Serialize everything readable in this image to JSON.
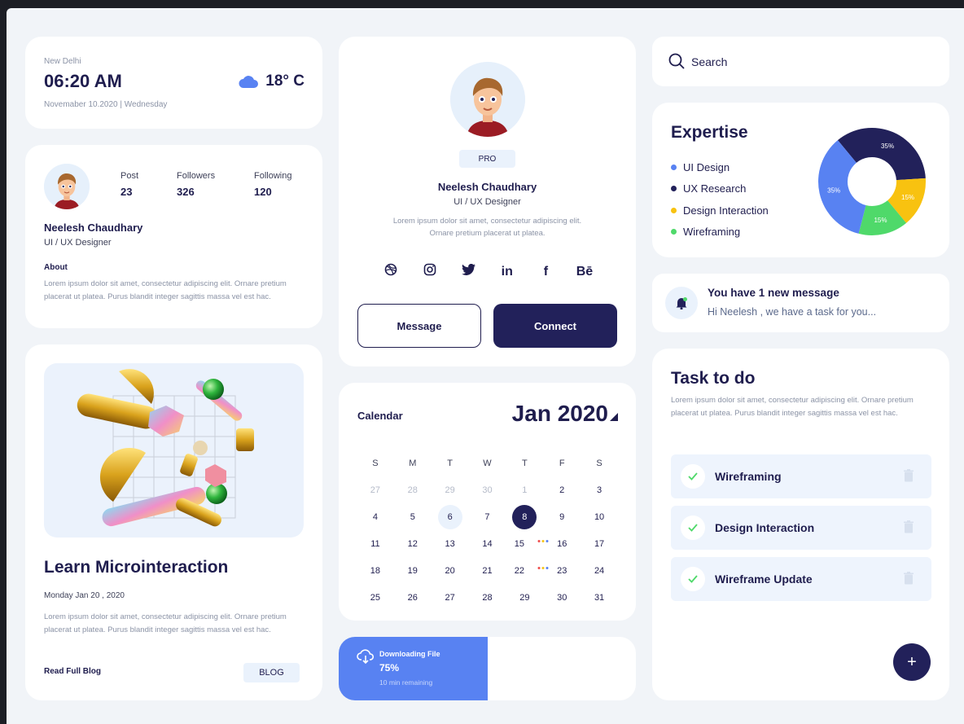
{
  "weather": {
    "city": "New Delhi",
    "time": "06:20 AM",
    "date": "Novemaber 10.2020 | Wednesday",
    "temperature": "18° C",
    "icon": "cloud-icon"
  },
  "profile_small": {
    "stats": [
      {
        "label": "Post",
        "value": "23"
      },
      {
        "label": "Followers",
        "value": "326"
      },
      {
        "label": "Following",
        "value": "120"
      }
    ],
    "name": "Neelesh Chaudhary",
    "role": "UI / UX Designer",
    "about_label": "About",
    "about_text": "Lorem ipsum dolor sit amet, consectetur adipiscing elit. Ornare pretium placerat ut platea. Purus blandit integer sagittis massa vel est hac."
  },
  "blog": {
    "title": "Learn Microinteraction",
    "date": "Monday Jan 20 , 2020",
    "text": "Lorem ipsum dolor sit amet, consectetur adipiscing elit. Ornare pretium placerat ut platea. Purus blandit integer sagittis massa vel est hac.",
    "read_link": "Read Full Blog",
    "tag": "BLOG"
  },
  "profile_big": {
    "badge": "PRO",
    "name": "Neelesh Chaudhary",
    "role": "UI / UX Designer",
    "bio": "Lorem ipsum dolor sit amet, consectetur adipiscing elit. Ornare pretium placerat ut platea.",
    "socials": [
      "dribbble-icon",
      "instagram-icon",
      "twitter-icon",
      "linkedin-icon",
      "facebook-icon",
      "behance-icon"
    ],
    "social_glyphs": {
      "linkedin": "in",
      "facebook": "f",
      "behance": "Bē"
    },
    "message_label": "Message",
    "connect_label": "Connect"
  },
  "calendar": {
    "label": "Calendar",
    "month": "Jan 2020",
    "weekdays": [
      "S",
      "M",
      "T",
      "W",
      "T",
      "F",
      "S"
    ],
    "prev_days": [
      "27",
      "28",
      "29",
      "30",
      "1"
    ],
    "days": [
      "2",
      "3",
      "4",
      "5",
      "6",
      "7",
      "8",
      "9",
      "10",
      "11",
      "12",
      "13",
      "14",
      "15",
      "16",
      "17",
      "18",
      "19",
      "20",
      "21",
      "22",
      "23",
      "24",
      "25",
      "26",
      "27",
      "28",
      "29",
      "30",
      "31"
    ],
    "today": "6",
    "selected": "8",
    "event_days": [
      "15",
      "22"
    ],
    "event_dot_colors": [
      "#ef4d4d",
      "#f5c518",
      "#5882f2"
    ]
  },
  "download": {
    "title": "Downloading File",
    "progress_label": "75%",
    "progress": 0.75,
    "remaining": "10 min remaining",
    "fill_color": "#5882f2"
  },
  "search": {
    "placeholder": "Search"
  },
  "expertise": {
    "title": "Expertise",
    "items": [
      {
        "label": "UI Design",
        "color": "#5882f2"
      },
      {
        "label": "UX Research",
        "color": "#22215a"
      },
      {
        "label": "Design Interaction",
        "color": "#f8c210"
      },
      {
        "label": "Wireframing",
        "color": "#4fd96a"
      }
    ],
    "slices": [
      {
        "label": "35%",
        "value": 35,
        "color": "#22215a"
      },
      {
        "label": "15%",
        "value": 15,
        "color": "#f8c210"
      },
      {
        "label": "15%",
        "value": 15,
        "color": "#4fd96a"
      },
      {
        "label": "35%",
        "value": 35,
        "color": "#5882f2"
      }
    ]
  },
  "notification": {
    "title": "You have 1 new message",
    "text": "Hi Neelesh , we have a task for you..."
  },
  "tasks": {
    "title": "Task to do",
    "text": "Lorem ipsum dolor sit amet, consectetur adipiscing elit. Ornare pretium placerat ut platea. Purus blandit integer sagittis massa vel est hac.",
    "items": [
      "Wireframing",
      "Design Interaction",
      "Wireframe Update"
    ],
    "add_label": "+"
  }
}
